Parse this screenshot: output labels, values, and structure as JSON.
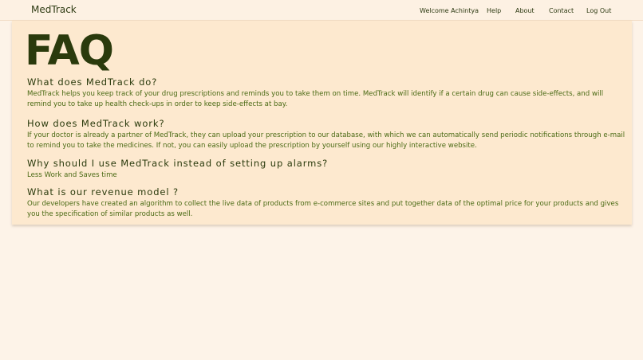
{
  "navbar": {
    "brand": "MedTrack",
    "welcome": "Welcome Achintya",
    "links": {
      "help": "Help",
      "about": "About",
      "contact": "Contact",
      "logout": "Log Out"
    }
  },
  "faq": {
    "title": "FAQ",
    "items": [
      {
        "question": "What does MedTrack do?",
        "answer": "MedTrack helps you keep track of your drug prescriptions and reminds you to take them on time. MedTrack will identify if a certain drug can cause side-effects, and will remind you to take up health check-ups in order to keep side-effects at bay."
      },
      {
        "question": "How does MedTrack work?",
        "answer": "If your doctor is already a partner of MedTrack, they can upload your prescription to our database, with which we can automatically send periodic notifications through e-mail to remind you to take the medicines. If not, you can easily upload the prescription by yourself using our highly interactive website."
      },
      {
        "question": "Why should I use MedTrack instead of setting up alarms?",
        "answer": "Less Work and Saves time"
      },
      {
        "question": "What is our revenue model ?",
        "answer": "Our developers have created an algorithm to collect the live data of products from e-commerce sites and put together data of the optimal price for your products and gives you the specification of similar products as well."
      }
    ]
  },
  "colors": {
    "page_background": "#fdf3e8",
    "navbar_background": "#fdf1e3",
    "card_background": "#fde9cf",
    "heading_color": "#2a3a0c",
    "answer_color": "#4a6a14"
  }
}
